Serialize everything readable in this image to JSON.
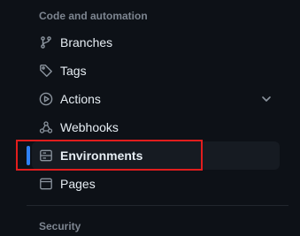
{
  "sections": {
    "code_automation_heading": "Code and automation",
    "security_heading": "Security"
  },
  "nav": {
    "items": [
      {
        "label": "Branches",
        "icon": "git-branch-icon"
      },
      {
        "label": "Tags",
        "icon": "tag-icon"
      },
      {
        "label": "Actions",
        "icon": "play-icon",
        "expandable": true
      },
      {
        "label": "Webhooks",
        "icon": "webhook-icon"
      },
      {
        "label": "Environments",
        "icon": "server-icon",
        "selected": true
      },
      {
        "label": "Pages",
        "icon": "browser-icon"
      }
    ]
  },
  "colors": {
    "background": "#0d1117",
    "selected_background": "#161b22",
    "text": "#e6edf3",
    "muted_text": "#7d8590",
    "accent": "#2f81f7",
    "highlight": "#e11d1d"
  }
}
